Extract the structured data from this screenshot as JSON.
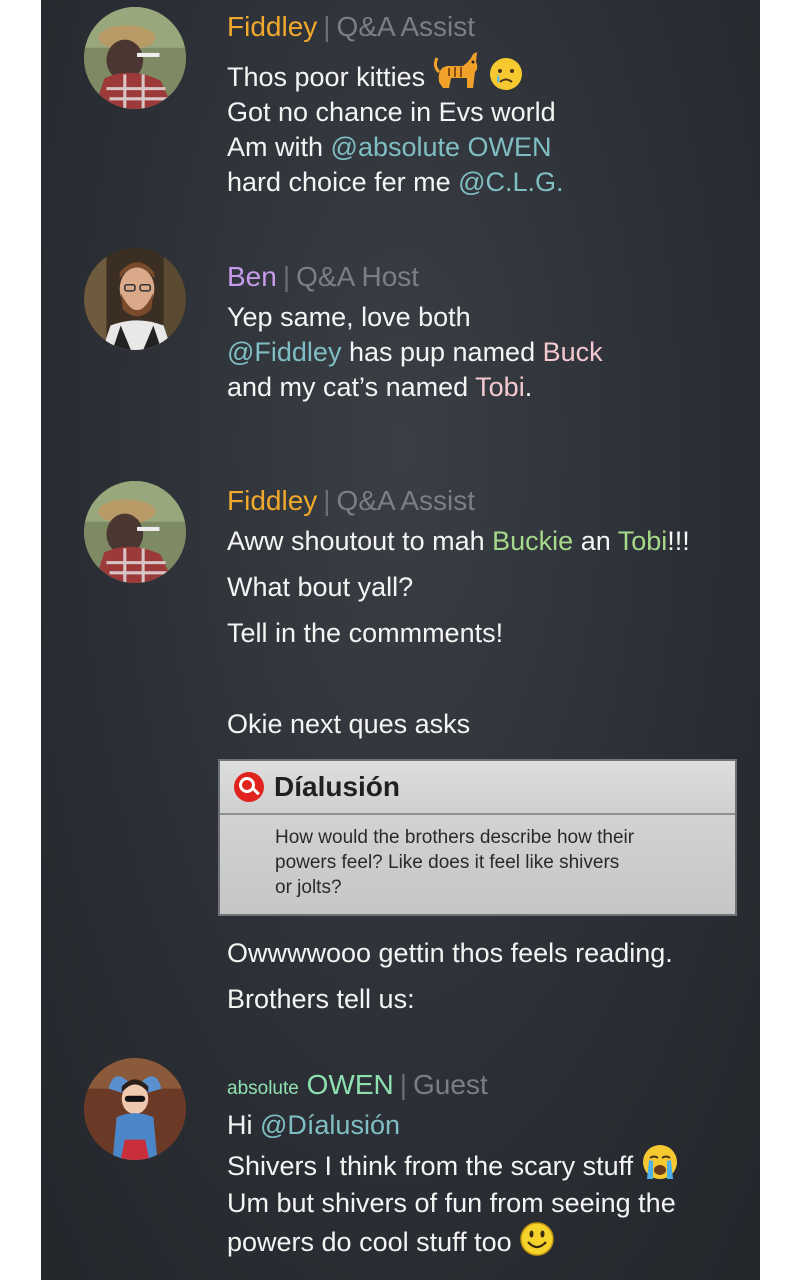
{
  "colors": {
    "fiddley": "#f0a92c",
    "ben": "#c79bea",
    "owen": "#8fe0b0",
    "mention": "#7fbfc4",
    "role": "#7a7e85"
  },
  "posts": [
    {
      "username": "Fiddley",
      "role": "Q&A Assist",
      "lines": {
        "l1": "Thos poor kitties",
        "l2": "Got no chance in Evs world",
        "l3_prefix": "Am with ",
        "l3_mention": "@absolute OWEN",
        "l4_prefix": "hard choice fer me ",
        "l4_mention": "@C.L.G."
      },
      "emojis": [
        "cat-emoji",
        "crying-face-emoji"
      ]
    },
    {
      "username": "Ben",
      "role": "Q&A Host",
      "lines": {
        "l1": "Yep same, love both",
        "l2_mention": "@Fiddley",
        "l2_text": " has pup named ",
        "l2_pet": "Buck",
        "l3_text": "and my cat’s named ",
        "l3_pet": "Tobi",
        "l3_end": "."
      }
    },
    {
      "username": "Fiddley",
      "role": "Q&A Assist",
      "lines": {
        "l1_text": "Aww shoutout to mah ",
        "l1_pet1": "Buckie",
        "l1_mid": " an ",
        "l1_pet2": "Tobi",
        "l1_end": "!!!",
        "l2": "What bout yall?",
        "l3": "Tell in the commments!",
        "l4": "Okie next ques asks",
        "l5": "Owwwwooo gettin thos feels reading.",
        "l6": "Brothers tell us:"
      },
      "question": {
        "asker": "Díalusión",
        "text": "How would the brothers describe how their powers feel? Like does it feel like shivers or jolts?"
      }
    },
    {
      "username_prefix": "absolute",
      "username": "OWEN",
      "role": "Guest",
      "lines": {
        "l1_text": "Hi ",
        "l1_mention": "@Díalusión",
        "l2": "Shivers I think from the scary stuff",
        "l3": "Um but shivers of fun from seeing the",
        "l4": "powers do cool stuff too"
      },
      "emojis": [
        "loudly-crying-face-emoji",
        "smiley-face-emoji"
      ]
    }
  ]
}
